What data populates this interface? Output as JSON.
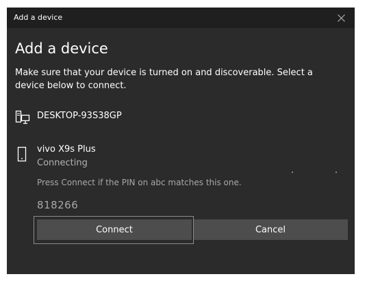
{
  "window": {
    "title": "Add a device"
  },
  "dialog": {
    "heading": "Add a device",
    "instructions": "Make sure that your device is turned on and discoverable. Select a device below to connect."
  },
  "devices": [
    {
      "name": "DESKTOP-93S38GP",
      "icon": "desktop-computer-icon"
    },
    {
      "name": "vivo X9s Plus",
      "status": "Connecting",
      "icon": "mobile-phone-icon"
    }
  ],
  "pairing": {
    "instruction": "Press Connect if the PIN on abc matches this one.",
    "pin": "818266"
  },
  "buttons": {
    "connect": "Connect",
    "cancel": "Cancel"
  },
  "colors": {
    "window_background": "#2b2b2b",
    "titlebar_background": "#1f1f1f",
    "button_background": "#4d4d4d",
    "secondary_text": "#a8a8a8"
  }
}
